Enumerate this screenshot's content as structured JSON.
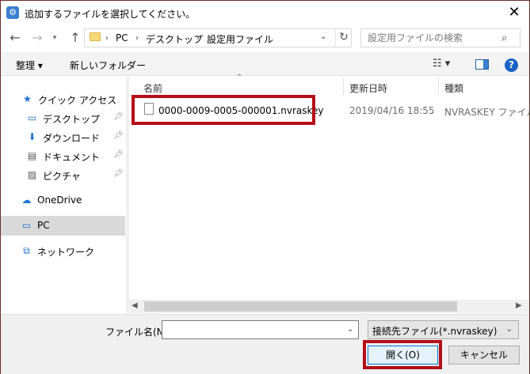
{
  "window": {
    "title": "追加するファイルを選択してください。",
    "app_icon": "gear-icon",
    "close_symbol": "✕"
  },
  "address": {
    "crumbs": [
      "PC",
      "デスクトップ",
      "設定用ファイル"
    ],
    "search_placeholder": "設定用ファイルの検索"
  },
  "toolbar": {
    "organize_label": "整理 ▾",
    "new_folder_label": "新しいフォルダー",
    "help_symbol": "?"
  },
  "nav": {
    "items": [
      {
        "label": "クイック アクセス",
        "icon": "star-icon",
        "glyph": "★",
        "pinned": false
      },
      {
        "label": "デスクトップ",
        "icon": "desktop-icon",
        "glyph": "▭",
        "pinned": true
      },
      {
        "label": "ダウンロード",
        "icon": "download-icon",
        "glyph": "⬇",
        "pinned": true
      },
      {
        "label": "ドキュメント",
        "icon": "document-icon",
        "glyph": "▤",
        "pinned": true
      },
      {
        "label": "ピクチャ",
        "icon": "picture-icon",
        "glyph": "▨",
        "pinned": true
      },
      {
        "label": "OneDrive",
        "icon": "cloud-icon",
        "glyph": "☁",
        "pinned": false
      },
      {
        "label": "PC",
        "icon": "computer-icon",
        "glyph": "▭",
        "pinned": false
      },
      {
        "label": "ネットワーク",
        "icon": "network-icon",
        "glyph": "⧉",
        "pinned": false
      }
    ],
    "selected": "PC"
  },
  "list": {
    "columns": {
      "name": "名前",
      "date": "更新日時",
      "type": "種類"
    },
    "files": [
      {
        "name": "0000-0009-0005-000001.nvraskey",
        "date": "2019/04/16 18:55",
        "type": "NVRASKEY ファイル"
      }
    ]
  },
  "bottom": {
    "filename_label": "ファイル名(N):",
    "filename_value": "",
    "filter_label": "接続先ファイル(*.nvraskey)",
    "open_label": "開く(O)",
    "cancel_label": "キャンセル"
  },
  "colors": {
    "highlight": "#b40f18",
    "accent": "#0078d7",
    "selected_nav": "#d9d9d9"
  }
}
